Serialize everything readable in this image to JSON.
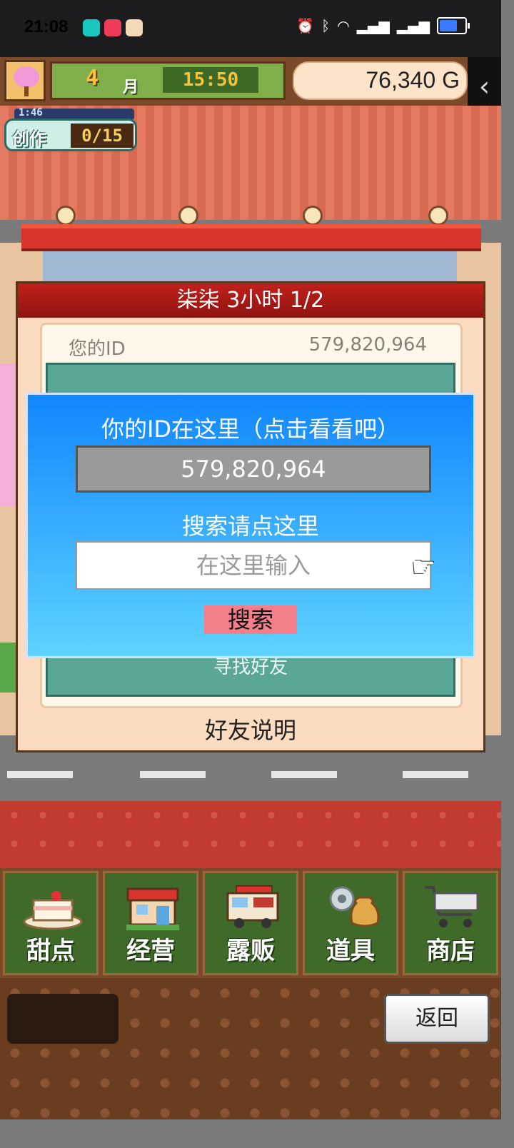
{
  "status_bar": {
    "time": "21:08",
    "app_icons": [
      "tap-icon",
      "heart-app-icon",
      "cat-app-icon"
    ],
    "indicators": [
      "alarm-icon",
      "bluetooth-icon",
      "wifi-icon",
      "5g-signal-icon",
      "5g-signal-icon",
      "battery-charging-icon"
    ]
  },
  "game_header": {
    "month_number": "4",
    "month_label": "月",
    "clock": "15:50",
    "money": "76,340 G"
  },
  "create_badge": {
    "timer": "1:46",
    "label": "创作",
    "count": "0/15"
  },
  "friends_panel": {
    "title": "柒柒  3小时 1/2",
    "id_label": "您的ID",
    "id_value": "579,820,964",
    "find_friends": "寻找好友",
    "help_label": "好友说明"
  },
  "id_dialog": {
    "title": "你的ID在这里（点击看看吧）",
    "id_value": "579,820,964",
    "search_prompt": "搜索请点这里",
    "input_placeholder": "在这里输入",
    "input_value": "",
    "search_button": "搜索"
  },
  "bottom_menu": [
    {
      "label": "甜点",
      "icon": "cake-icon"
    },
    {
      "label": "经营",
      "icon": "shop-icon"
    },
    {
      "label": "露贩",
      "icon": "food-truck-icon"
    },
    {
      "label": "道具",
      "icon": "item-bag-icon"
    },
    {
      "label": "商店",
      "icon": "cart-icon"
    }
  ],
  "footer": {
    "back_button": "返回"
  },
  "colors": {
    "dialog_blue": "#1187ff",
    "panel_title_red": "#c1211c",
    "teal": "#5aa797",
    "search_pink": "#f47f8a"
  }
}
